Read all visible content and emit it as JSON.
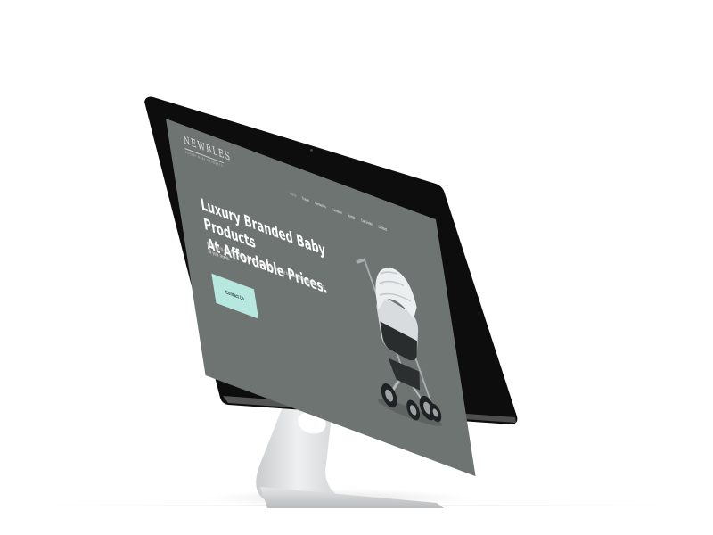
{
  "site": {
    "logo_text": "NEWBLES",
    "logo_tagline": "LUXURY BABY PRODUCTS"
  },
  "nav": {
    "items": [
      {
        "label": "Home"
      },
      {
        "label": "Travel"
      },
      {
        "label": "Nurseries"
      },
      {
        "label": "Furniture"
      },
      {
        "label": "Buggy"
      },
      {
        "label": "Car Seats"
      },
      {
        "label": "Contact"
      }
    ]
  },
  "hero": {
    "headline_line1": "Luxury Branded Baby Products",
    "headline_line2": "At Affordable Prices.",
    "description": "Newbles is a family run business that provides luxury branded baby products for all your needs.",
    "cta_label": "Contact Us"
  },
  "colors": {
    "screen_bg": "#6e7472",
    "cta_bg": "#b7e8df",
    "bezel": "#0d0d0d"
  },
  "icons": {
    "product_image": "stroller-image",
    "brand_mark": "apple-logo-icon"
  }
}
